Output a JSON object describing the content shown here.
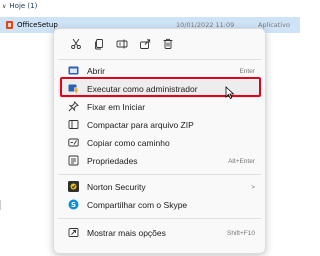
{
  "explorer": {
    "group_header": "Hoje (1)",
    "file": {
      "name": "OfficeSetup",
      "date": "10/01/2022 11:09",
      "type": "Aplicativo"
    }
  },
  "quick_actions": [
    {
      "name": "cut-icon",
      "tooltip": "Recortar"
    },
    {
      "name": "copy-icon",
      "tooltip": "Copiar"
    },
    {
      "name": "rename-icon",
      "tooltip": "Renomear"
    },
    {
      "name": "share-icon",
      "tooltip": "Compartilhar"
    },
    {
      "name": "delete-icon",
      "tooltip": "Excluir"
    }
  ],
  "menu": {
    "items": [
      {
        "label": "Abrir",
        "shortcut": "Enter",
        "icon": "open-icon"
      },
      {
        "label": "Executar como administrador",
        "shortcut": "",
        "icon": "shield-icon"
      },
      {
        "label": "Fixar em Iniciar",
        "shortcut": "",
        "icon": "pin-icon"
      },
      {
        "label": "Compactar para arquivo ZIP",
        "shortcut": "",
        "icon": "zip-icon"
      },
      {
        "label": "Copiar como caminho",
        "shortcut": "",
        "icon": "path-icon"
      },
      {
        "label": "Propriedades",
        "shortcut": "Alt+Enter",
        "icon": "properties-icon"
      },
      {
        "label": "Norton Security",
        "shortcut": ">",
        "icon": "norton-icon"
      },
      {
        "label": "Compartilhar com o Skype",
        "shortcut": "",
        "icon": "skype-icon"
      },
      {
        "label": "Mostrar mais opções",
        "shortcut": "Shift+F10",
        "icon": "more-options-icon"
      }
    ]
  },
  "colors": {
    "highlight_border": "#e2001a",
    "selection": "#cfe3f7"
  }
}
